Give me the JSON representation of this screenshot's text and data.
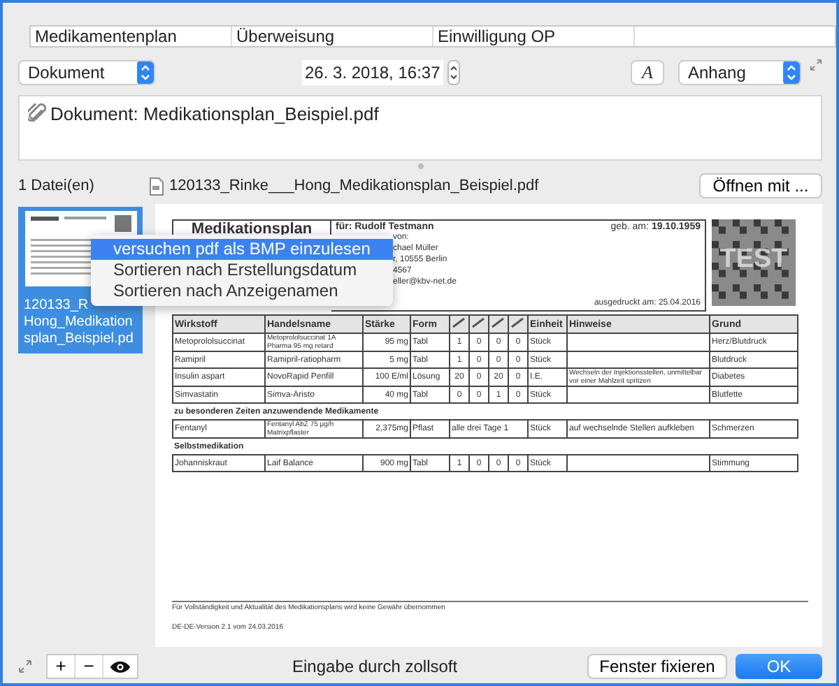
{
  "tabs": [
    {
      "label": "Medikamentenplan"
    },
    {
      "label": "Überweisung"
    },
    {
      "label": "Einwilligung OP"
    }
  ],
  "document_type": {
    "value": "Dokument"
  },
  "date": {
    "value": "26. 3. 2018, 16:37"
  },
  "font_button": {
    "label": "A"
  },
  "attachment_type": {
    "value": "Anhang"
  },
  "note": {
    "text": "Dokument: Medikationsplan_Beispiel.pdf"
  },
  "file_count": "1 Datei(en)",
  "files": [
    {
      "caption_lines": [
        "120133_R",
        "Hong_Medikation",
        "splan_Beispiel.pd"
      ],
      "selected": true
    }
  ],
  "context_menu": {
    "items": [
      {
        "label": "versuchen pdf als BMP einzulesen",
        "selected": true
      },
      {
        "label": "Sortieren nach Erstellungsdatum",
        "selected": false
      },
      {
        "label": "Sortieren nach Anzeigenamen",
        "selected": false
      }
    ]
  },
  "preview": {
    "filename": "120133_Rinke___Hong_Medikationsplan_Beispiel.pdf",
    "open_button": "Öffnen mit ...",
    "document": {
      "title": "Medikationsplan",
      "patient": "für: Rudolf Testmann",
      "birth_label": "geb. am:",
      "birth": "19.10.1959",
      "issuer_lines": [
        "von:",
        "chael Müller",
        "r, 10555 Berlin",
        "4567",
        "eller@kbv-net.de"
      ],
      "printed": "ausgedruckt am: 25.04.2016",
      "barcode_text": "TEST",
      "columns": [
        "Wirkstoff",
        "Handelsname",
        "Stärke",
        "Form",
        "Einheit",
        "Hinweise",
        "Grund"
      ],
      "rows": [
        {
          "kind": "med",
          "cells": [
            "Metoprololsuccinat",
            "Metoprololsuccinat 1A Pharma 95 mg retard",
            "95 mg",
            "Tabl"
          ],
          "dose": [
            "1",
            "0",
            "0",
            "0"
          ],
          "tail": {
            "unit": "Stück",
            "reason": "Herz/Blutdruck"
          }
        },
        {
          "kind": "med",
          "cells": [
            "Ramipril",
            "Ramipril-ratiopharm",
            "5 mg",
            "Tabl"
          ],
          "dose": [
            "1",
            "0",
            "0",
            "0"
          ],
          "tail": {
            "unit": "Stück",
            "reason": "Blutdruck"
          }
        },
        {
          "kind": "med",
          "cells": [
            "Insulin aspart",
            "NovoRapid  Penfill",
            "100 E/ml",
            "Lösung"
          ],
          "dose": [
            "20",
            "0",
            "20",
            "0"
          ],
          "tail": {
            "unit": "I.E.",
            "note": "Wechseln der Injektionsstellen, unmittelbar vor einer Mahlzeit spritzen",
            "reason": "Diabetes"
          }
        },
        {
          "kind": "med",
          "cells": [
            "Simvastatin",
            "Simva-Aristo",
            "40 mg",
            "Tabl"
          ],
          "dose": [
            "0",
            "0",
            "1",
            "0"
          ],
          "tail": {
            "unit": "Stück",
            "reason": "Blutfette"
          }
        },
        {
          "kind": "section",
          "title": "zu besonderen Zeiten anzuwendende Medikamente"
        },
        {
          "kind": "interval",
          "cells": [
            "Fentanyl",
            "Fentanyl AbZ 75 µg/h Matrixpflaster",
            "2,375mg",
            "Pflast"
          ],
          "interval": "alle drei Tage 1",
          "tail": {
            "unit": "Stück",
            "note": "auf wechselnde Stellen aufkleben",
            "reason": "Schmerzen"
          }
        },
        {
          "kind": "section",
          "title": "Selbstmedikation"
        },
        {
          "kind": "med",
          "cells": [
            "Johanniskraut",
            "Laif Balance",
            "900 mg",
            "Tabl"
          ],
          "dose": [
            "1",
            "0",
            "0",
            "0"
          ],
          "tail": {
            "unit": "Stück",
            "reason": "Stimmung"
          }
        }
      ],
      "footer_lines": [
        "Für Vollständigkeit und Aktualität des Medikationsplans wird keine Gewähr übernommen",
        "DE-DE-Version 2.1 vom 24.03.2016"
      ]
    }
  },
  "footer": {
    "tools": [
      {
        "label": "+"
      },
      {
        "label": "−"
      }
    ],
    "status": "Eingabe durch zollsoft",
    "buttons": [
      {
        "label": "Fenster fixieren",
        "kind": "secondary"
      },
      {
        "label": "OK",
        "kind": "primary"
      }
    ]
  }
}
